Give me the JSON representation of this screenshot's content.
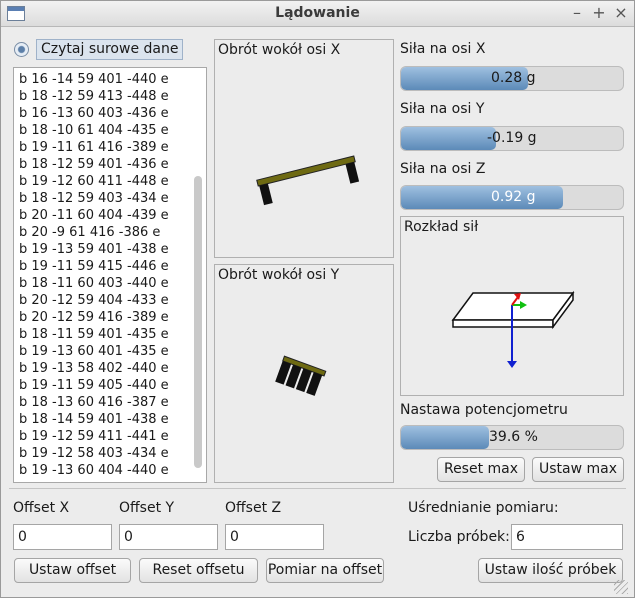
{
  "window": {
    "title": "Lądowanie"
  },
  "source": {
    "raw_label": "Czytaj surowe dane",
    "selected": true
  },
  "raw_lines": [
    "b 16 -14 59 401 -440 e",
    "b 18 -12 59 413 -448 e",
    "b 16 -13 60 403 -436 e",
    "b 18 -10 61 404 -435 e",
    "b 19 -11 61 416 -389 e",
    "b 18 -12 59 401 -436 e",
    "b 19 -12 60 411 -448 e",
    "b 18 -12 59 403 -434 e",
    "b 20 -11 60 404 -439 e",
    "b 20 -9 61 416 -386 e",
    "b 19 -13 59 401 -438 e",
    "b 19 -11 59 415 -446 e",
    "b 18 -11 60 403 -440 e",
    "b 20 -12 59 404 -433 e",
    "b 20 -12 59 416 -389 e",
    "b 18 -11 59 401 -435 e",
    "b 19 -13 60 401 -435 e",
    "b 19 -13 58 402 -440 e",
    "b 19 -11 59 405 -440 e",
    "b 18 -13 60 416 -387 e",
    "b 18 -14 59 401 -438 e",
    "b 19 -12 59 411 -441 e",
    "b 19 -12 58 403 -434 e",
    "b 19 -13 60 404 -440 e"
  ],
  "rotation": {
    "x_title": "Obrót wokół osi X",
    "y_title": "Obrót wokół osi Y"
  },
  "forces": {
    "x": {
      "label": "Siła na osi X",
      "text": "0.28 g",
      "fraction": 0.57
    },
    "y": {
      "label": "Siła na osi Y",
      "text": "-0.19 g",
      "fraction": 0.43
    },
    "z": {
      "label": "Siła na osi Z",
      "text": "0.92 g",
      "fraction": 0.73
    }
  },
  "distribution": {
    "title": "Rozkład sił"
  },
  "pot": {
    "label": "Nastawa potencjometru",
    "text": "39.6 %",
    "fraction": 0.396
  },
  "buttons": {
    "reset_max": "Reset max",
    "set_max": "Ustaw max",
    "set_offset": "Ustaw offset",
    "reset_offset": "Reset offsetu",
    "measure_offset": "Pomiar na offset",
    "set_samples": "Ustaw ilość próbek"
  },
  "offsets": {
    "x_label": "Offset X",
    "x_value": "0",
    "y_label": "Offset Y",
    "y_value": "0",
    "z_label": "Offset Z",
    "z_value": "0"
  },
  "averaging": {
    "title": "Uśrednianie pomiaru:",
    "samples_label": "Liczba próbek:",
    "samples_value": "6"
  },
  "colors": {
    "beam": "#6e6a12",
    "leg": "#111111",
    "axis_x": "#e01010",
    "axis_y": "#10c010",
    "axis_z": "#1020d0",
    "bar_fill": "#5c8ab8"
  }
}
